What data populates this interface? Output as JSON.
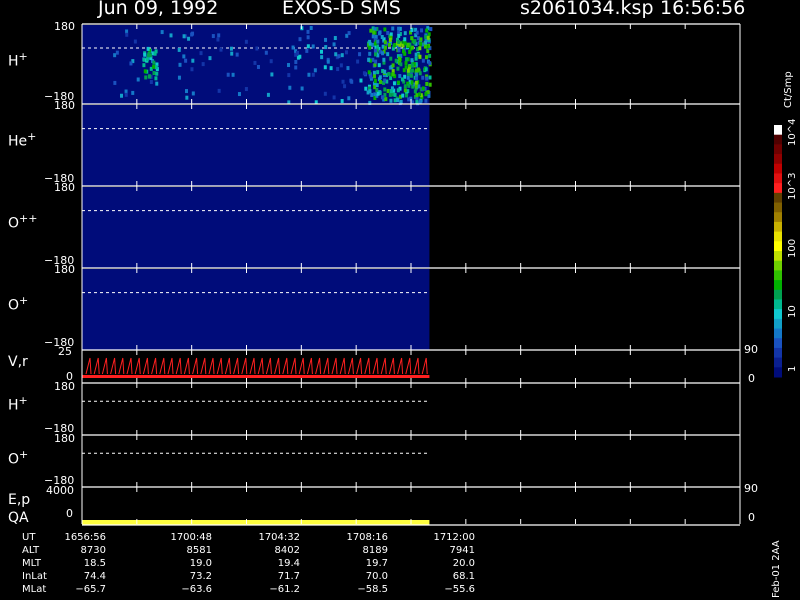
{
  "header": {
    "date": "Jun 09, 1992",
    "instrument": "EXOS-D SMS",
    "file": "s2061034.ksp",
    "time": "16:56:56"
  },
  "colors": {
    "background": "#000000",
    "spectrogram_base": "#000c7a",
    "axis": "#ffffff",
    "velocity_trace": "#ff2020",
    "qa_bar": "#ffff40"
  },
  "colorbar": {
    "unit": "Ct/Smp",
    "labels": [
      "1",
      "10",
      "100",
      "10^3",
      "10^4"
    ],
    "colors": [
      "#000c7a",
      "#0a1f90",
      "#1335a8",
      "#1a52c0",
      "#1478c8",
      "#12a0c8",
      "#10c8d0",
      "#00b890",
      "#00a050",
      "#00b000",
      "#30c000",
      "#70d000",
      "#c0e000",
      "#ffff00",
      "#e8e000",
      "#c8b000",
      "#a08000",
      "#806000",
      "#604000",
      "#ff2020",
      "#e01010",
      "#c00000",
      "#900000",
      "#700000",
      "#500000",
      "#ffffff"
    ]
  },
  "panels": [
    {
      "id": "h_plus",
      "label": "H",
      "sup": "+",
      "ytick_top": "180",
      "ytick_bottom": "−180"
    },
    {
      "id": "he_plus",
      "label": "He",
      "sup": "+",
      "ytick_top": "180",
      "ytick_bottom": "−180"
    },
    {
      "id": "o_pp",
      "label": "O",
      "sup": "++",
      "ytick_top": "180",
      "ytick_bottom": "−180"
    },
    {
      "id": "o_plus",
      "label": "O",
      "sup": "+",
      "ytick_top": "180",
      "ytick_bottom": "−180"
    },
    {
      "id": "vr",
      "label": "V,r",
      "sup": "",
      "ytick_top": "25",
      "ytick_bottom": "0",
      "rtick_top": "90",
      "rtick_bottom": "0"
    },
    {
      "id": "h_plus_2",
      "label": "H",
      "sup": "+",
      "ytick_top": "180",
      "ytick_bottom": "−180"
    },
    {
      "id": "o_plus_2",
      "label": "O",
      "sup": "+",
      "ytick_top": "180",
      "ytick_bottom": "−180"
    },
    {
      "id": "ep_qa",
      "label": "E,p",
      "label2": "QA",
      "ytick_top": "4000",
      "ytick_bottom": "0",
      "rtick_top": "90",
      "rtick_bottom": "0"
    }
  ],
  "chart_data": {
    "type": "heatmap",
    "title": "Jun 09, 1992   EXOS-D SMS",
    "xlabel": "UT",
    "x_tick_labels": [
      "1656:56",
      "1700:48",
      "1704:32",
      "1708:16",
      "1712:00"
    ],
    "data_coverage_fraction": 0.5,
    "ylim_spectrogram": [
      -180,
      180
    ],
    "ylim_velocity": [
      0,
      25
    ],
    "ylim_energy": [
      0,
      4000
    ],
    "right_axis_angle": [
      0,
      90
    ],
    "series": [
      {
        "species": "H+",
        "activity": "moderate fluxes near start, strong enhanced fluxes (green/yellow) near end of data coverage"
      },
      {
        "species": "He+",
        "activity": "low background"
      },
      {
        "species": "O++",
        "activity": "low background"
      },
      {
        "species": "O+",
        "activity": "low background"
      }
    ]
  },
  "ephemeris": {
    "rows": [
      {
        "name": "UT",
        "values": [
          "1656:56",
          "1700:48",
          "1704:32",
          "1708:16",
          "1712:00"
        ]
      },
      {
        "name": "ALT",
        "values": [
          "8730",
          "8581",
          "8402",
          "8189",
          "7941"
        ]
      },
      {
        "name": "MLT",
        "values": [
          "18.5",
          "19.0",
          "19.4",
          "19.7",
          "20.0"
        ]
      },
      {
        "name": "InLat",
        "values": [
          "74.4",
          "73.2",
          "71.7",
          "70.0",
          "68.1"
        ]
      },
      {
        "name": "MLat",
        "values": [
          "−65.7",
          "−63.6",
          "−61.2",
          "−58.5",
          "−55.6"
        ]
      }
    ]
  },
  "footer": {
    "side_note": "Feb-01 2AA"
  }
}
